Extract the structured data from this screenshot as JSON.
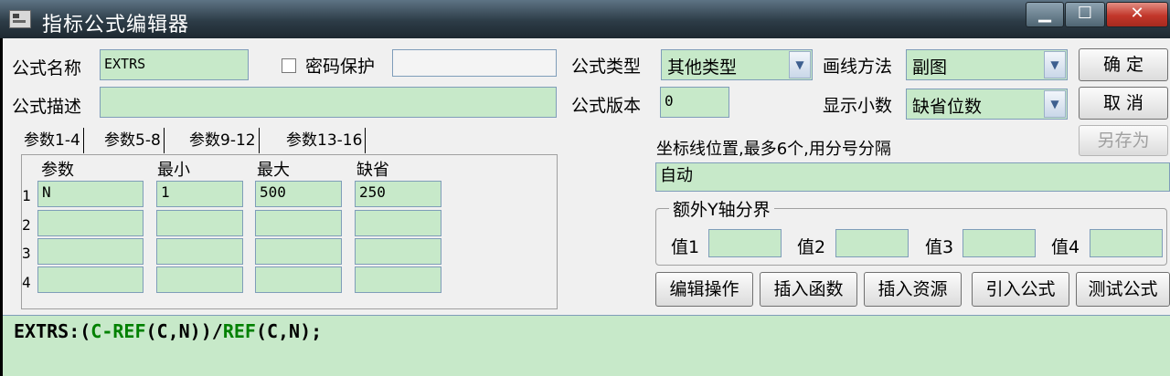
{
  "window": {
    "title": "指标公式编辑器",
    "minimize_label": "▁",
    "maximize_label": "☐",
    "close_label": "✕"
  },
  "header": {
    "name_label": "公式名称",
    "name_value": "EXTRS",
    "password_label": "密码保护",
    "password_value": "",
    "desc_label": "公式描述",
    "desc_value": "",
    "type_label": "公式类型",
    "type_value": "其他类型",
    "version_label": "公式版本",
    "version_value": "0",
    "draw_label": "画线方法",
    "draw_value": "副图",
    "decimals_label": "显示小数",
    "decimals_value": "缺省位数"
  },
  "actions": {
    "ok": "确  定",
    "cancel": "取  消",
    "save_as": "另存为"
  },
  "tabs": [
    "参数1-4",
    "参数5-8",
    "参数9-12",
    "参数13-16"
  ],
  "params": {
    "headers": [
      "参数",
      "最小",
      "最大",
      "缺省"
    ],
    "rows": [
      {
        "num": "1",
        "name": "N",
        "min": "1",
        "max": "500",
        "default": "250"
      },
      {
        "num": "2",
        "name": "",
        "min": "",
        "max": "",
        "default": ""
      },
      {
        "num": "3",
        "name": "",
        "min": "",
        "max": "",
        "default": ""
      },
      {
        "num": "4",
        "name": "",
        "min": "",
        "max": "",
        "default": ""
      }
    ]
  },
  "axis": {
    "label": "坐标线位置,最多6个,用分号分隔",
    "value": "自动",
    "extra_group": "额外Y轴分界",
    "val1_label": "值1",
    "val2_label": "值2",
    "val3_label": "值3",
    "val4_label": "值4",
    "val1": "",
    "val2": "",
    "val3": "",
    "val4": ""
  },
  "tools": {
    "edit_ops": "编辑操作",
    "insert_func": "插入函数",
    "insert_res": "插入资源",
    "import_formula": "引入公式",
    "test_formula": "测试公式"
  },
  "editor": {
    "code_parts": [
      "EXTRS:(",
      "C-REF",
      "(C,N))/",
      "REF",
      "(C,N);"
    ]
  },
  "colors": {
    "field_bg": "#c7e9c9",
    "keyword": "#008000",
    "dialog_bg": "#f0f0f0"
  }
}
